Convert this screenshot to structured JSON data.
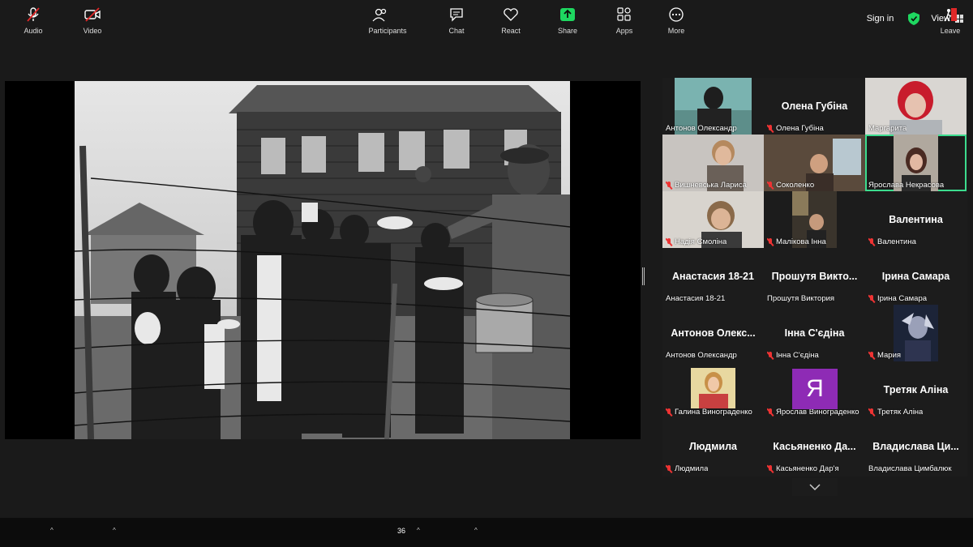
{
  "topbar": {
    "signin": "Sign in",
    "view": "View"
  },
  "gallery": {
    "tiles": [
      {
        "big": "",
        "label": "Антонов Олександр",
        "muted": false
      },
      {
        "big": "Олена Губіна",
        "label": "Олена Губіна",
        "muted": true
      },
      {
        "big": "",
        "label": "Маргарита",
        "muted": false
      },
      {
        "big": "",
        "label": "Вишневська Лариса",
        "muted": true
      },
      {
        "big": "",
        "label": "Соколенко",
        "muted": true
      },
      {
        "big": "",
        "label": "Ярослава Некрасова",
        "muted": false
      },
      {
        "big": "",
        "label": "Надія Смоліна",
        "muted": true
      },
      {
        "big": "",
        "label": "Малікова Інна",
        "muted": true
      },
      {
        "big": "Валентина",
        "label": "Валентина",
        "muted": true
      },
      {
        "big": "Анастасия 18-21",
        "label": "Анастасия 18-21",
        "muted": false
      },
      {
        "big": "Прошутя Викто...",
        "label": "Прошутя Виктория",
        "muted": false
      },
      {
        "big": "Ірина Самара",
        "label": "Ірина Самара",
        "muted": true
      },
      {
        "big": "Антонов Олекс...",
        "label": "Антонов Олександр",
        "muted": false
      },
      {
        "big": "Інна С'єдіна",
        "label": "Інна С'єдіна",
        "muted": true
      },
      {
        "big": "",
        "label": "Мария",
        "muted": true
      },
      {
        "big": "",
        "label": "Галина Винограденко",
        "muted": true
      },
      {
        "big": "",
        "label": "Ярослав Винограденко",
        "muted": true
      },
      {
        "big": "Третяк Аліна",
        "label": "Третяк Аліна",
        "muted": true
      },
      {
        "big": "Людмила",
        "label": "Людмила",
        "muted": true
      },
      {
        "big": "Касьяненко Да...",
        "label": "Касьяненко Дар'я",
        "muted": true
      },
      {
        "big": "Владислава Ци...",
        "label": "Владислава Цимбалюк",
        "muted": false
      }
    ],
    "avatar_letter": "Я"
  },
  "toolbar": {
    "audio": "Audio",
    "video": "Video",
    "participants": "Participants",
    "participants_count": "36",
    "chat": "Chat",
    "react": "React",
    "share": "Share",
    "apps": "Apps",
    "more": "More",
    "leave": "Leave"
  },
  "colors": {
    "active_border": "#3cdc8e",
    "muted": "#e33333",
    "share_green": "#1ed760",
    "leave_red": "#e02828"
  }
}
